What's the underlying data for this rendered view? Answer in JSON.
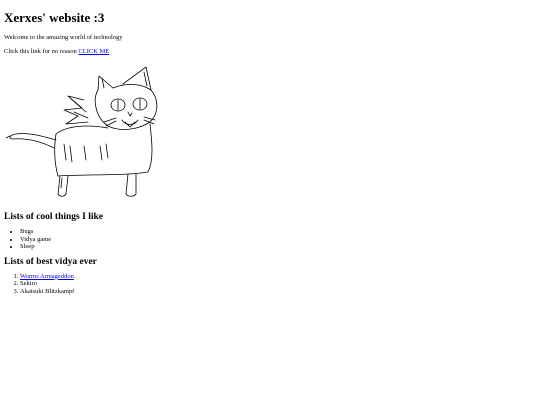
{
  "page": {
    "title": "Xerxes' website :3",
    "welcome": "Welcome to the amazing world of technology",
    "link_intro": "Click this link for no reason",
    "link_text": "CLICK ME"
  },
  "drawing": {
    "subject": "hand-drawn cat doodle",
    "icon": "cat-drawing-icon"
  },
  "cool_things": {
    "heading": "Lists of cool things I like",
    "items": [
      "Bugs",
      "Vidya game",
      "Sleep"
    ]
  },
  "best_vidya": {
    "heading": "Lists of best vidya ever",
    "items": [
      "Worms Armageddon",
      "Sekiro",
      "Akatsuki Blitzkampf"
    ]
  },
  "colors": {
    "link": "#0000ee",
    "text": "#000000",
    "background": "#ffffff"
  }
}
